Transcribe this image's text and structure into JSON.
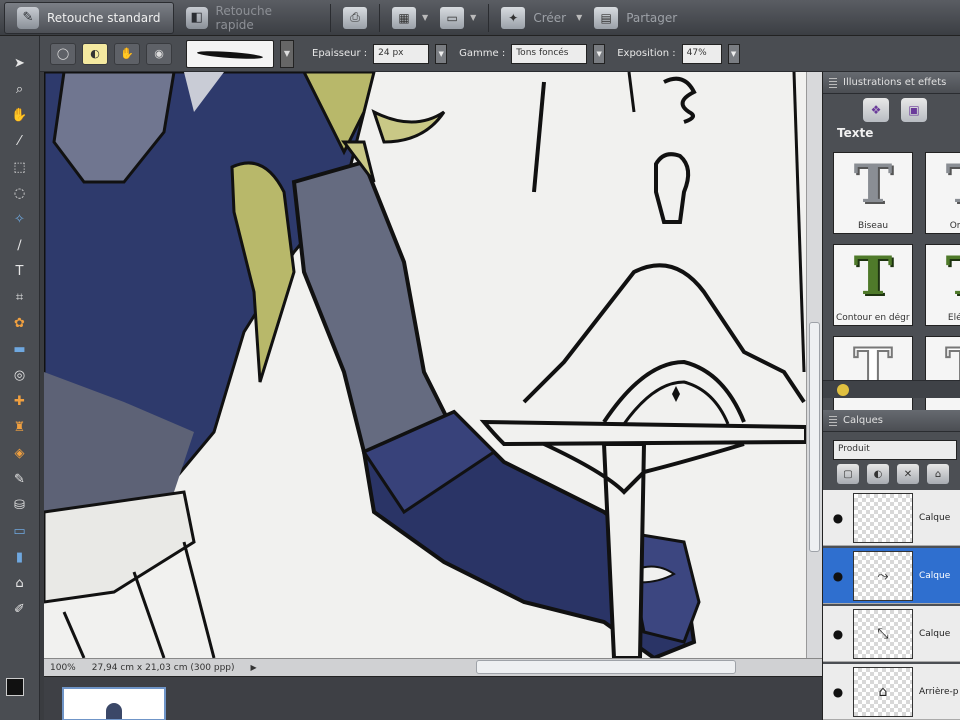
{
  "modebar": {
    "mode_active": "Retouche standard",
    "mode_inactive": "Retouche rapide",
    "create_label": "Créer",
    "share_label": "Partager",
    "icons": {
      "active": "photo-tool-icon",
      "inactive": "quick-fix-icon",
      "print": "print-icon",
      "organize": "organize-icon",
      "open": "open-folder-icon",
      "create": "create-icon",
      "share": "share-icon"
    }
  },
  "options": {
    "thickness_label": "Epaisseur :",
    "thickness_value": "24 px",
    "range_label": "Gamme :",
    "range_value": "Tons foncés",
    "exposure_label": "Exposition :",
    "exposure_value": "47%"
  },
  "status": {
    "zoom": "100%",
    "dimensions": "27,94 cm x 21,03 cm (300 ppp)"
  },
  "panel": {
    "effects_title": "Illustrations et effets",
    "section_title": "Texte",
    "effects": [
      {
        "caption": "Biseau",
        "style": "chrome"
      },
      {
        "caption": "Ombre",
        "style": "chrome"
      },
      {
        "caption": "Contour en dégradé",
        "style": "green"
      },
      {
        "caption": "Elégant",
        "style": "green"
      },
      {
        "caption": "",
        "style": "outline"
      },
      {
        "caption": "",
        "style": "outline"
      }
    ],
    "layers_title": "Calques",
    "blend_mode": "Produit",
    "layers": [
      {
        "name": "Calque",
        "selected": false
      },
      {
        "name": "Calque",
        "selected": true
      },
      {
        "name": "Calque",
        "selected": false
      },
      {
        "name": "Arrière-plan",
        "selected": false
      }
    ]
  },
  "colors": {
    "accent": "#2f6fcf",
    "ink": "#111111",
    "armor_dark": "#2a3466",
    "armor_mid": "#3c4680",
    "skin_grey": "#6e7488",
    "horn": "#b8b86a"
  }
}
